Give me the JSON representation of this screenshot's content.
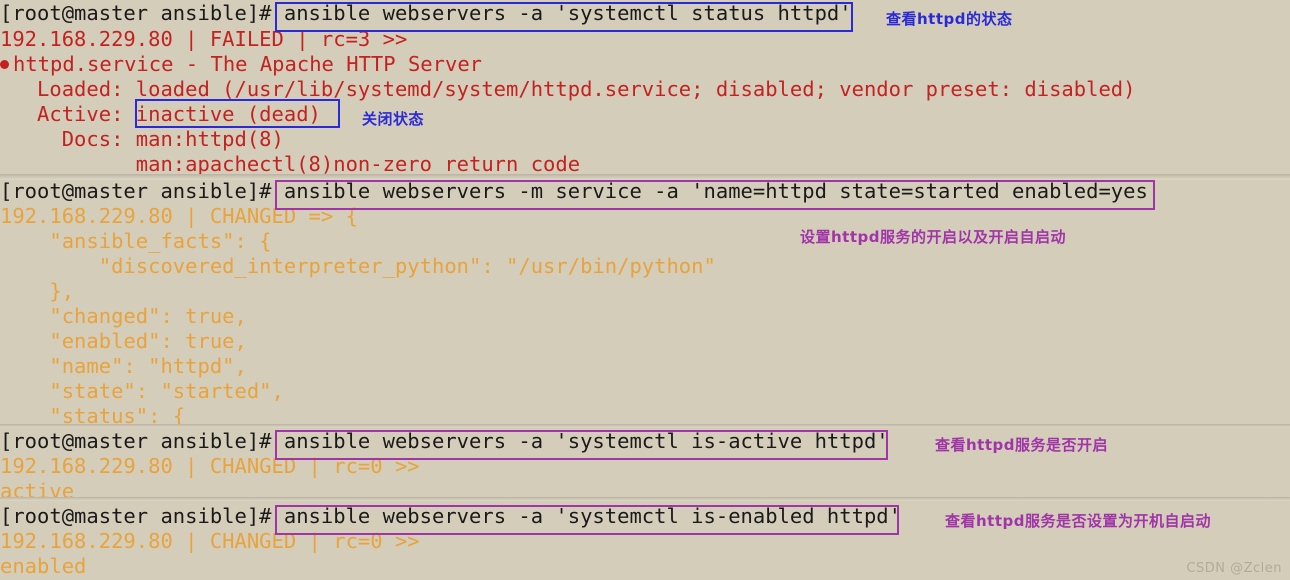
{
  "terminal": {
    "background_color": "#d4cdba",
    "prompt_color": "#1a1a1a",
    "error_color": "#c42121",
    "changed_color": "#e8a33d",
    "box_blue_color": "#2a2ad6",
    "box_purple_color": "#a034a8",
    "prompt": "[root@master ansible]# ",
    "blocks": [
      {
        "id": "block-status",
        "command": "ansible webservers -a 'systemctl status httpd'",
        "output": [
          "192.168.229.80 | FAILED | rc=3 >>",
          "httpd.service - The Apache HTTP Server",
          "   Loaded: loaded (/usr/lib/systemd/system/httpd.service; disabled; vendor preset: disabled)",
          "   Active: inactive (dead)",
          "     Docs: man:httpd(8)",
          "           man:apachectl(8)non-zero return code"
        ]
      },
      {
        "id": "block-start-enable",
        "command": "ansible webservers -m service -a 'name=httpd state=started enabled=yes'",
        "output": [
          "192.168.229.80 | CHANGED => {",
          "    \"ansible_facts\": {",
          "        \"discovered_interpreter_python\": \"/usr/bin/python\"",
          "    },",
          "    \"changed\": true,",
          "    \"enabled\": true,",
          "    \"name\": \"httpd\",",
          "    \"state\": \"started\",",
          "    \"status\": {"
        ]
      },
      {
        "id": "block-is-active",
        "command": "ansible webservers -a 'systemctl is-active httpd'",
        "output": [
          "192.168.229.80 | CHANGED | rc=0 >>",
          "active"
        ]
      },
      {
        "id": "block-is-enabled",
        "command": "ansible webservers -a 'systemctl is-enabled httpd'",
        "output": [
          "192.168.229.80 | CHANGED | rc=0 >>",
          "enabled"
        ]
      }
    ],
    "annotations": [
      {
        "id": "anno-1",
        "text": "查看httpd的状态",
        "color": "blue"
      },
      {
        "id": "anno-2",
        "text": "关闭状态",
        "color": "blue"
      },
      {
        "id": "anno-3",
        "text": "设置httpd服务的开启以及开启自启动",
        "color": "purple"
      },
      {
        "id": "anno-4",
        "text": "查看httpd服务是否开启",
        "color": "purple"
      },
      {
        "id": "anno-5",
        "text": "查看httpd服务是否设置为开机自启动",
        "color": "purple"
      }
    ],
    "highlight_boxes": [
      {
        "id": "hl-cmd-1",
        "color": "blue"
      },
      {
        "id": "hl-inactive",
        "color": "blue"
      },
      {
        "id": "hl-cmd-2",
        "color": "purple"
      },
      {
        "id": "hl-cmd-3",
        "color": "purple"
      },
      {
        "id": "hl-cmd-4",
        "color": "purple"
      }
    ],
    "watermark": "CSDN @Zclen"
  }
}
